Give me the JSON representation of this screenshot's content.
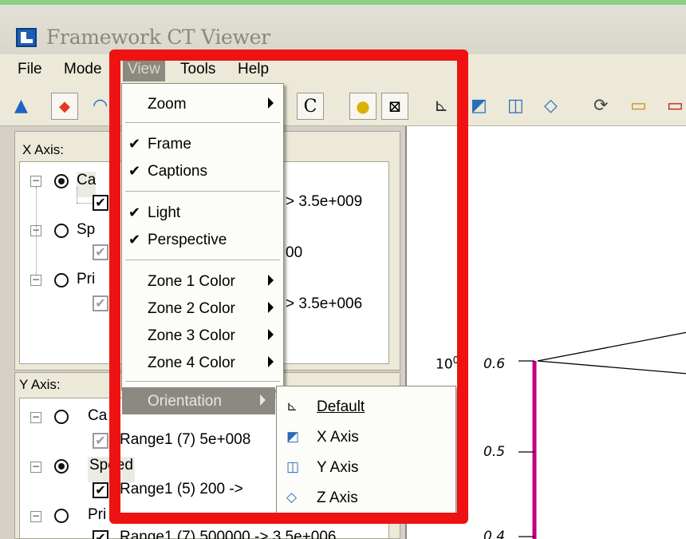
{
  "window": {
    "title": "Framework CT Viewer"
  },
  "menubar": {
    "items": [
      "File",
      "Mode",
      "View",
      "Tools",
      "Help"
    ]
  },
  "toolbar": {
    "c_label": "C"
  },
  "x_axis_panel": {
    "label": "X Axis:",
    "items": [
      {
        "name": "Ca",
        "selected": true,
        "range_text": "> 3.5e+009",
        "checked": true
      },
      {
        "name": "Sp",
        "selected": false,
        "range_text": "00",
        "checked": false
      },
      {
        "name": "Pri",
        "selected": false,
        "range_text": "> 3.5e+006",
        "checked": false
      }
    ]
  },
  "y_axis_panel": {
    "label": "Y Axis:",
    "items": [
      {
        "name": "Ca",
        "selected": false,
        "range_text": "Range1 (7)  5e+008",
        "checked": false
      },
      {
        "name": "Speed",
        "selected": true,
        "range_text": "Range1 (5)  200 ->",
        "checked": true
      },
      {
        "name": "Pri",
        "selected": false,
        "range_text": "Range1 (7)  500000 -> 3.5e+006",
        "checked": true
      }
    ]
  },
  "chart": {
    "label_left": "10",
    "label_left_sup": "0",
    "y_ticks": [
      "0.6",
      "0.5",
      "0.4"
    ]
  },
  "view_menu": {
    "zoom": "Zoom",
    "frame": "Frame",
    "captions": "Captions",
    "light": "Light",
    "perspective": "Perspective",
    "zone1": "Zone 1 Color",
    "zone2": "Zone 2 Color",
    "zone3": "Zone 3 Color",
    "zone4": "Zone 4 Color",
    "orientation": "Orientation"
  },
  "orientation_submenu": {
    "default": "Default",
    "x_axis": "X Axis",
    "y_axis": "Y Axis",
    "z_axis": "Z Axis"
  },
  "checkmark": "✔"
}
